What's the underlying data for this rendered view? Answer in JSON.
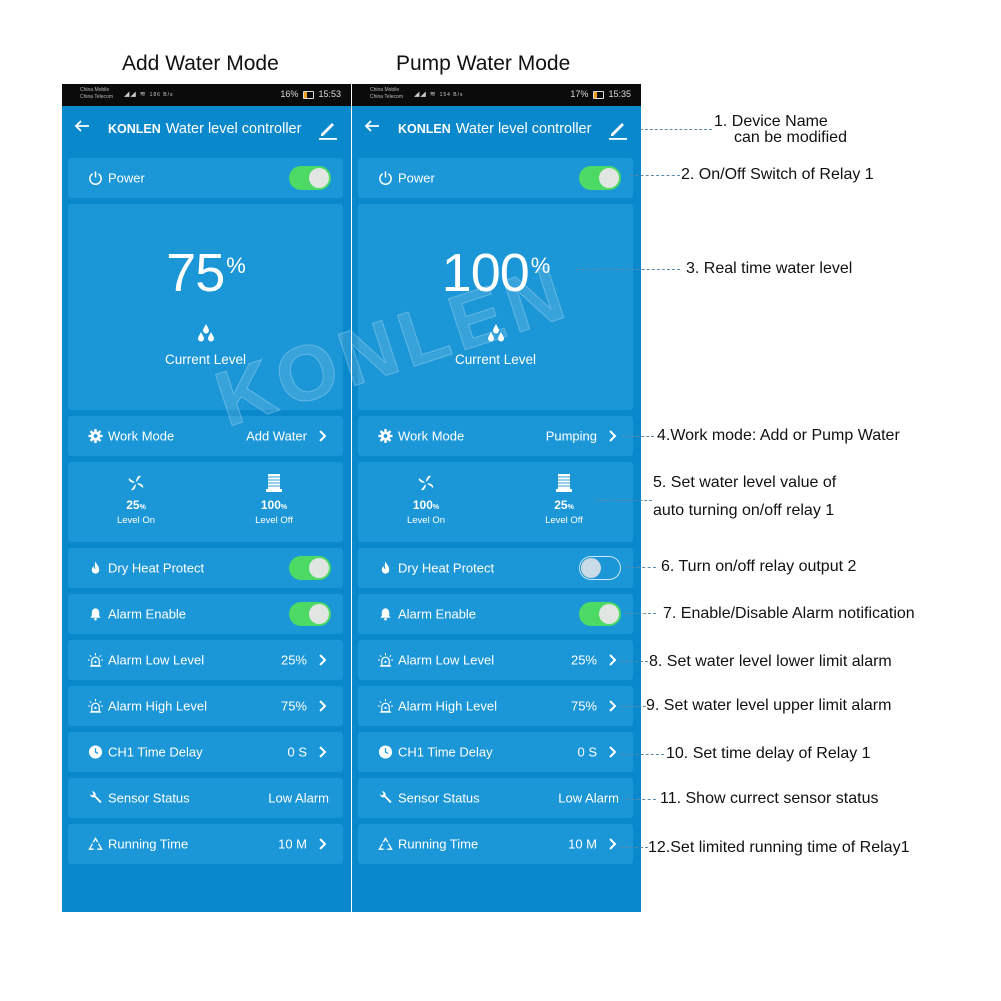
{
  "headings": {
    "left": "Add Water Mode",
    "right": "Pump Water Mode"
  },
  "phones": [
    {
      "status": {
        "carrier1": "China Mobile",
        "carrier2": "China Telecom",
        "net_speed": "186 B/s",
        "battery": "16%",
        "time": "15:53"
      },
      "app": {
        "brand": "KONLEN",
        "title": "Water level controller"
      },
      "power": {
        "label": "Power",
        "on": true
      },
      "level": {
        "value": "75",
        "unit": "%",
        "label": "Current Level"
      },
      "work_mode": {
        "label": "Work Mode",
        "value": "Add Water"
      },
      "level_on": {
        "value": "25",
        "unit": "%",
        "label": "Level On"
      },
      "level_off": {
        "value": "100",
        "unit": "%",
        "label": "Level Off"
      },
      "dry_heat": {
        "label": "Dry Heat Protect",
        "on": true
      },
      "alarm_enable": {
        "label": "Alarm Enable",
        "on": true
      },
      "alarm_low": {
        "label": "Alarm Low Level",
        "value": "25%"
      },
      "alarm_high": {
        "label": "Alarm High Level",
        "value": "75%"
      },
      "time_delay": {
        "label": "CH1 Time Delay",
        "value": "0 S"
      },
      "sensor_status": {
        "label": "Sensor Status",
        "value": "Low Alarm"
      },
      "running_time": {
        "label": "Running Time",
        "value": "10 M"
      }
    },
    {
      "status": {
        "carrier1": "China Mobile",
        "carrier2": "China Telecom",
        "net_speed": "154 B/s",
        "battery": "17%",
        "time": "15:35"
      },
      "app": {
        "brand": "KONLEN",
        "title": "Water level controller"
      },
      "power": {
        "label": "Power",
        "on": true
      },
      "level": {
        "value": "100",
        "unit": "%",
        "label": "Current Level"
      },
      "work_mode": {
        "label": "Work Mode",
        "value": "Pumping"
      },
      "level_on": {
        "value": "100",
        "unit": "%",
        "label": "Level On"
      },
      "level_off": {
        "value": "25",
        "unit": "%",
        "label": "Level Off"
      },
      "dry_heat": {
        "label": "Dry Heat Protect",
        "on": false
      },
      "alarm_enable": {
        "label": "Alarm Enable",
        "on": true
      },
      "alarm_low": {
        "label": "Alarm Low Level",
        "value": "25%"
      },
      "alarm_high": {
        "label": "Alarm High Level",
        "value": "75%"
      },
      "time_delay": {
        "label": "CH1 Time Delay",
        "value": "0 S"
      },
      "sensor_status": {
        "label": "Sensor Status",
        "value": "Low Alarm"
      },
      "running_time": {
        "label": "Running Time",
        "value": "10 M"
      }
    }
  ],
  "watermark": "KONLEN",
  "annotations": [
    {
      "line1": "1. Device Name",
      "line2": "can be modified"
    },
    {
      "line1": "2. On/Off Switch of Relay 1"
    },
    {
      "line1": "3. Real time water level"
    },
    {
      "line1": "4.Work mode: Add or Pump Water"
    },
    {
      "line1": "5. Set water level value of",
      "line2": "auto turning on/off relay 1"
    },
    {
      "line1": "6. Turn on/off relay output 2"
    },
    {
      "line1": "7. Enable/Disable Alarm notification"
    },
    {
      "line1": "8. Set water level lower limit alarm"
    },
    {
      "line1": "9. Set water level upper limit alarm"
    },
    {
      "line1": "10. Set time delay of Relay 1"
    },
    {
      "line1": "11. Show currect sensor status"
    },
    {
      "line1": "12.Set limited running time of Relay1"
    }
  ],
  "colors": {
    "phone_bg": "#0a88cc",
    "card_bg": "#1b96d6",
    "toggle_on": "#4cd964",
    "status_bar": "#0b0b0b"
  }
}
